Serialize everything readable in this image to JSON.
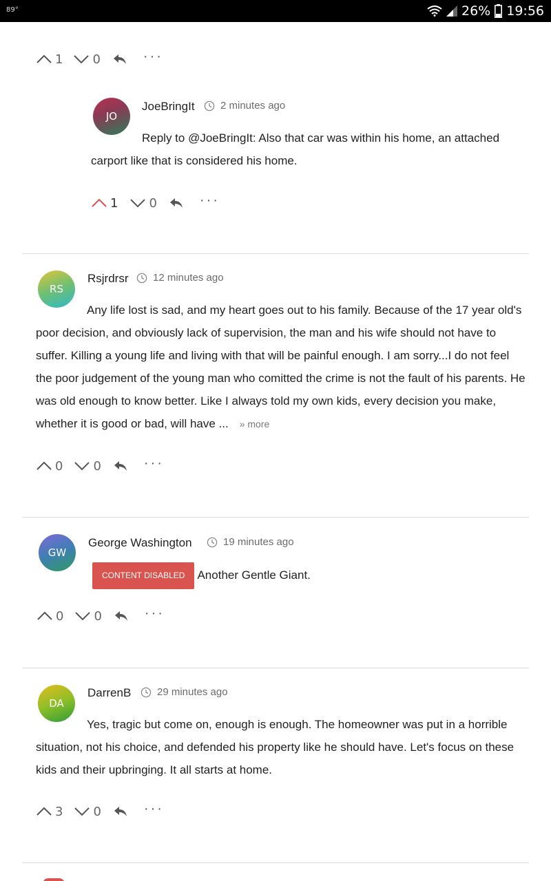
{
  "status_bar": {
    "temperature": "89°",
    "battery": "26%",
    "time": "19:56"
  },
  "top_actions": {
    "up": "1",
    "down": "0"
  },
  "comments": [
    {
      "initials": "JO",
      "username": "JoeBringIt",
      "time": "2 minutes ago",
      "text": "Reply to @JoeBringIt: Also that car was within his home, an attached carport like that is considered his home.",
      "up": "1",
      "down": "0"
    },
    {
      "initials": "RS",
      "username": "Rsjrdrsr",
      "time": "12 minutes ago",
      "text": "Any life lost is sad, and my heart goes out to his family. Because of the 17 year old's poor decision, and obviously lack of supervision, the man and his wife should not have to suffer. Killing a young life and living with that will be painful enough. I am sorry...I do not feel the poor judgement of the young man who comitted the crime is not the fault of his parents. He was old enough to know better. Like I always told my own kids, every decision you make, whether it is good or bad, will have ...",
      "more": "» more",
      "up": "0",
      "down": "0"
    },
    {
      "initials": "GW",
      "username": "George Washington",
      "time": "19 minutes ago",
      "badge": "CONTENT DISABLED",
      "text": "Another Gentle Giant.",
      "up": "0",
      "down": "0"
    },
    {
      "initials": "DA",
      "username": "DarrenB",
      "time": "29 minutes ago",
      "text": "Yes, tragic but come on, enough is enough. The homeowner was put in a horrible situation, not his choice, and defended his property like he should have. Let's focus on these kids and their upbringing. It all starts at home.",
      "up": "3",
      "down": "0"
    }
  ],
  "colors": {
    "upvote_active": "#d9534f",
    "badge": "#d9534f",
    "divider": "#dcdcdc"
  },
  "icons": {
    "up": "chevron-up-icon",
    "down": "chevron-down-icon",
    "reply": "reply-icon",
    "more": "more-dots-icon",
    "clock": "clock-icon"
  }
}
